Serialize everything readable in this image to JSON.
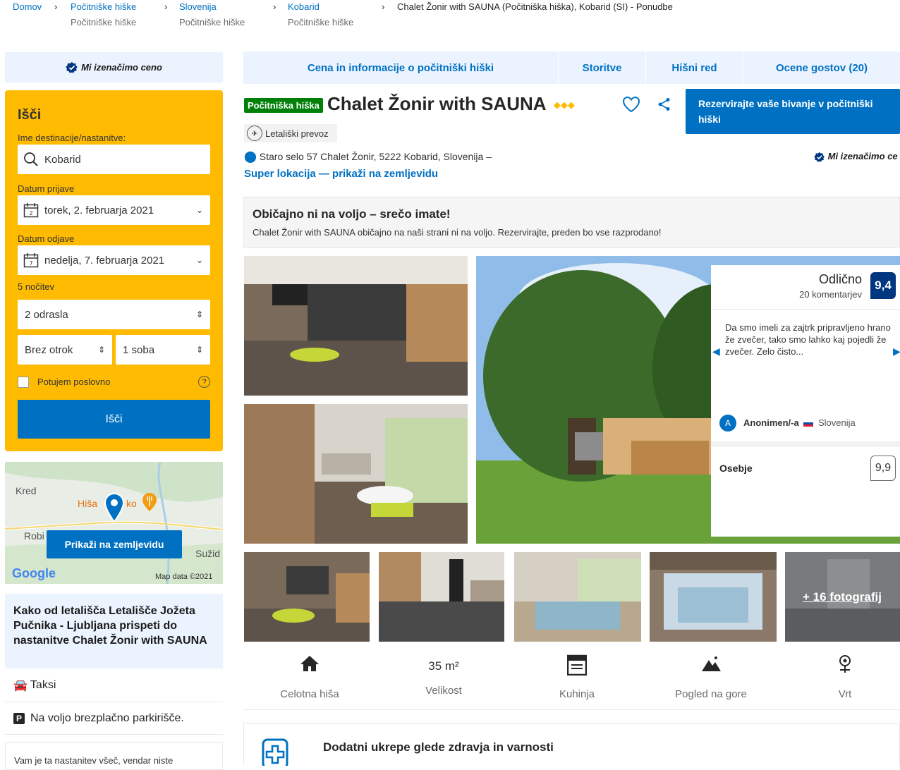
{
  "breadcrumb": [
    {
      "label": "Domov",
      "sub": ""
    },
    {
      "label": "Počitniške hiške",
      "sub": "Počitniške hiške"
    },
    {
      "label": "Slovenija",
      "sub": "Počitniške hiške"
    },
    {
      "label": "Kobarid",
      "sub": "Počitniške hiške"
    },
    {
      "label": "Chalet Žonir with SAUNA (Počitniška hiška), Kobarid (SI) - Ponudbe",
      "sub": ""
    }
  ],
  "price_match": "Mi izenačimo ceno",
  "search": {
    "title": "Išči",
    "dest_label": "Ime destinacije/nastanitve:",
    "dest_value": "Kobarid",
    "checkin_label": "Datum prijave",
    "checkin_value": "torek, 2. februarja 2021",
    "checkin_day": "2",
    "checkout_label": "Datum odjave",
    "checkout_value": "nedelja, 7. februarja 2021",
    "checkout_day": "7",
    "nights": "5 nočitev",
    "adults": "2 odrasla",
    "children": "Brez otrok",
    "rooms": "1 soba",
    "business": "Potujem poslovno",
    "button": "Išči"
  },
  "map": {
    "labels": [
      "Kred",
      "Hiša",
      "ko",
      "Robi",
      "Sužid"
    ],
    "button": "Prikaži na zemljevidu",
    "google": "Google",
    "credit": "Map data ©2021"
  },
  "airport": {
    "title": "Kako od letališča Letališče Jožeta Pučnika - Ljubljana prispeti do nastanitve Chalet Žonir with SAUNA",
    "taxi": "Taksi",
    "parking": "Na voljo brezplačno parkirišče.",
    "like": "Vam je ta nastanitev všeč, vendar niste"
  },
  "tabs": [
    "Cena in informacije o počitniški hiški",
    "Storitve",
    "Hišni red",
    "Ocene gostov (20)"
  ],
  "property": {
    "badge": "Počitniška hiška",
    "name": "Chalet Žonir with SAUNA",
    "stars": 3,
    "reserve": "Rezervirajte vaše bivanje v počitniški hiški",
    "shuttle": "Letališki prevoz",
    "address": "Staro selo 57 Chalet Žonir, 5222 Kobarid, Slovenija –",
    "super_location": "Super lokacija — prikaži na zemljevidu",
    "price_match_right": "Mi izenačimo ce"
  },
  "luck": {
    "title": "Običajno ni na voljo – srečo imate!",
    "text": "Chalet Žonir with SAUNA običajno na naši strani ni na voljo. Rezervirajte, preden bo vse razprodano!"
  },
  "review": {
    "rating_word": "Odlično",
    "count": "20 komentarjev",
    "score": "9,4",
    "quote": "Da smo imeli za zajtrk pripravljeno hrano že zvečer, tako smo lahko kaj pojedli že zvečer. Zelo čisto...",
    "avatar": "A",
    "author": "Anonimen/-a",
    "country": "Slovenija",
    "staff_label": "Osebje",
    "staff_score": "9,9"
  },
  "more_photos": "+ 16 fotografij",
  "amenities": [
    {
      "icon": "house-icon",
      "top": "",
      "label": "Celotna hiša"
    },
    {
      "icon": "size",
      "top": "35 m²",
      "label": "Velikost"
    },
    {
      "icon": "kitchen-icon",
      "top": "",
      "label": "Kuhinja"
    },
    {
      "icon": "mountain-icon",
      "top": "",
      "label": "Pogled na gore"
    },
    {
      "icon": "garden-icon",
      "top": "",
      "label": "Vrt"
    }
  ],
  "health": "Dodatni ukrepe glede zdravja in varnosti",
  "colors": {
    "brand": "#0071c2",
    "search_bg": "#febb02",
    "dark_blue": "#003580",
    "green": "#008009"
  }
}
